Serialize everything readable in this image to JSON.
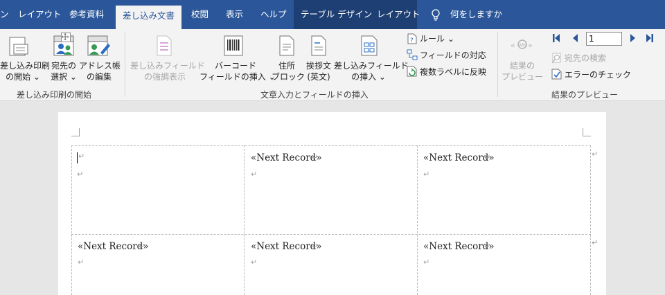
{
  "tabs": [
    {
      "label": "ン"
    },
    {
      "label": "レイアウト"
    },
    {
      "label": "参考資料"
    },
    {
      "label": "差し込み文書",
      "active": true
    },
    {
      "label": "校閲"
    },
    {
      "label": "表示"
    },
    {
      "label": "ヘルプ"
    },
    {
      "label": "テーブル デザイン"
    },
    {
      "label": "レイアウト"
    }
  ],
  "tell_me": "何をしますか",
  "ribbon": {
    "start": {
      "start_merge": [
        "差し込み印刷",
        "の開始 ⌄"
      ],
      "select_recipients": [
        "宛先の",
        "選択 ⌄"
      ],
      "edit_list": [
        "アドレス帳",
        "の編集"
      ],
      "group_label": "差し込み印刷の開始"
    },
    "insert": {
      "highlight": [
        "差し込みフィールド",
        "の強調表示"
      ],
      "barcode": [
        "バーコード",
        "フィールドの挿入 ⌄"
      ],
      "address_block": [
        "住所",
        "ブロック"
      ],
      "greeting": [
        "挨拶文",
        "(英文)"
      ],
      "merge_field": [
        "差し込みフィールド",
        "の挿入 ⌄"
      ],
      "rules": "ルール ⌄",
      "match_fields": "フィールドの対応",
      "update_labels": "複数ラベルに反映",
      "group_label": "文章入力とフィールドの挿入"
    },
    "preview": {
      "preview_results": [
        "結果の",
        "プレビュー"
      ],
      "record_number": "1",
      "find_recipient": "宛先の検索",
      "check_errors": "エラーのチェック",
      "group_label": "結果のプレビュー"
    }
  },
  "document": {
    "next_record": "«Next Record»",
    "para_mark": "↵",
    "end_mark": "↵"
  },
  "colors": {
    "tabbar": "#2b579a",
    "context_group": "#1e3f73",
    "ribbon": "#f3f3f3",
    "accent": "#2b579a"
  }
}
